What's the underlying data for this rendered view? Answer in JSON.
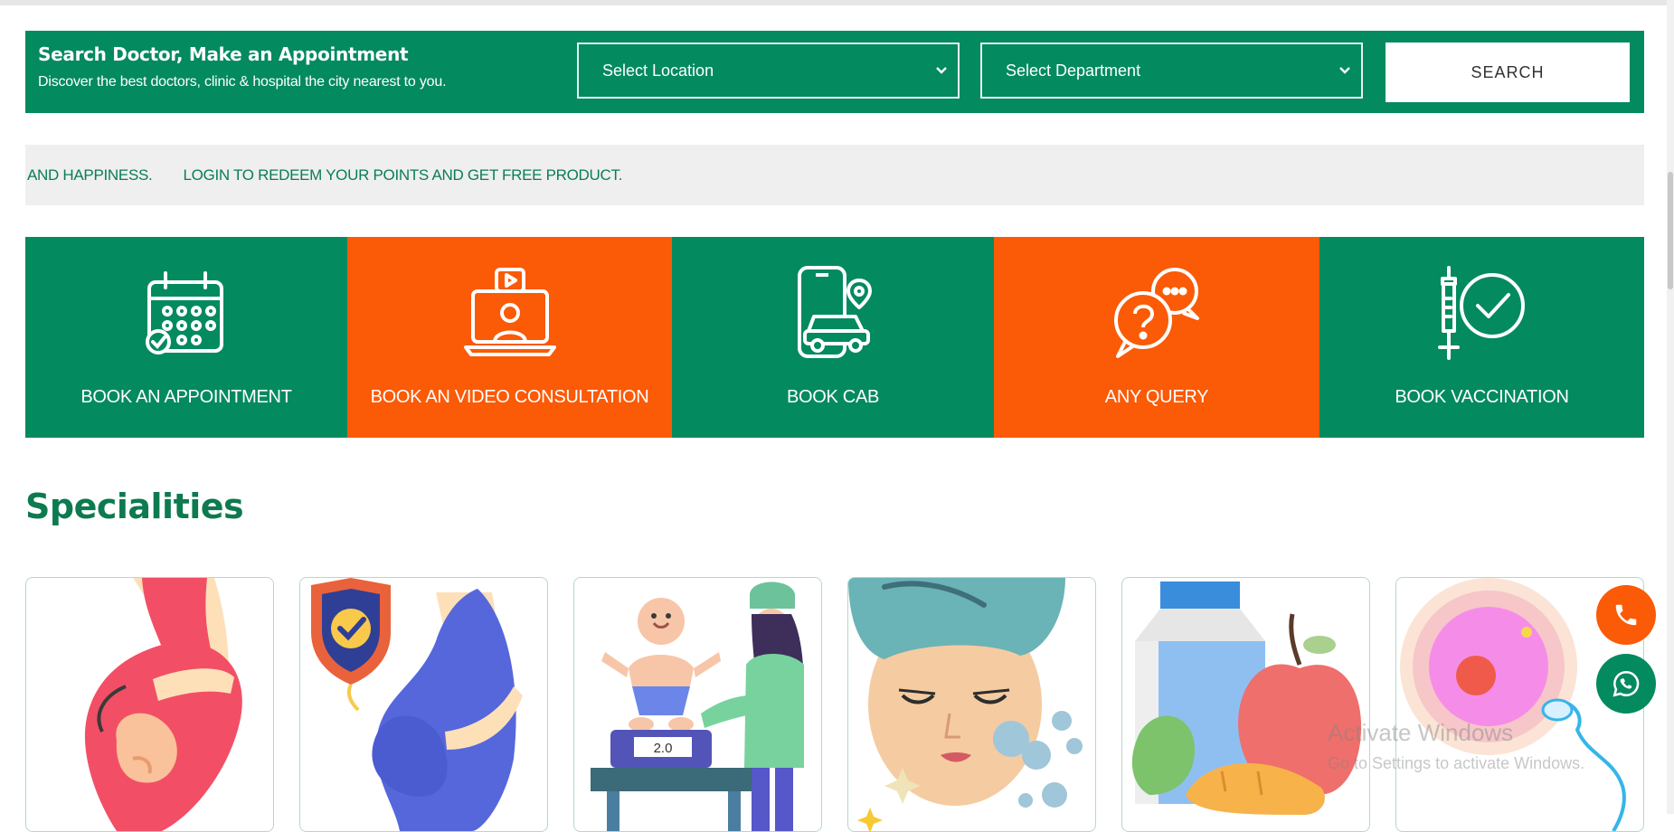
{
  "search": {
    "title": "Search Doctor, Make an Appointment",
    "subtitle": "Discover the best doctors, clinic & hospital the city nearest to you.",
    "location_select": "Select Location",
    "department_select": "Select Department",
    "button_label": "SEARCH"
  },
  "ticker": {
    "segment_1": "AND HAPPINESS.",
    "segment_2": "LOGIN TO REDEEM YOUR POINTS AND GET FREE PRODUCT."
  },
  "services": [
    {
      "label": "BOOK AN APPOINTMENT",
      "icon": "calendar-icon",
      "color": "#038a5f"
    },
    {
      "label": "BOOK AN VIDEO CONSULTATION",
      "icon": "video-consultation-icon",
      "color": "#fb5a06"
    },
    {
      "label": "BOOK CAB",
      "icon": "phone-car-icon",
      "color": "#038a5f"
    },
    {
      "label": "ANY QUERY",
      "icon": "question-chat-icon",
      "color": "#fb5a06"
    },
    {
      "label": "BOOK VACCINATION",
      "icon": "vaccine-icon",
      "color": "#038a5f"
    }
  ],
  "specialities": {
    "heading": "Specialities",
    "cards": [
      {
        "icon": "pregnancy-illustration"
      },
      {
        "icon": "maternity-protection-illustration"
      },
      {
        "icon": "pediatrics-baby-scale-illustration",
        "scale_reading": "2.0"
      },
      {
        "icon": "skincare-facial-illustration"
      },
      {
        "icon": "nutrition-food-illustration"
      },
      {
        "icon": "fertility-cell-illustration"
      }
    ]
  },
  "floating": {
    "call_icon": "phone-icon",
    "whatsapp_icon": "whatsapp-icon"
  },
  "watermark": {
    "line1": "Activate Windows",
    "line2": "Go to Settings to activate Windows."
  },
  "colors": {
    "brand_green": "#038a5f",
    "brand_orange": "#fb5a06",
    "heading_green": "#0d7a4f"
  }
}
